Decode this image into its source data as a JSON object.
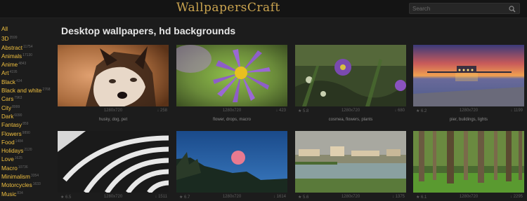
{
  "site": {
    "logo": "WallpapersCraft"
  },
  "search": {
    "placeholder": "Search"
  },
  "page": {
    "title": "Desktop wallpapers, hd backgrounds"
  },
  "sidebar": {
    "items": [
      {
        "label": "All",
        "count": ""
      },
      {
        "label": "3D",
        "count": "3599"
      },
      {
        "label": "Abstract",
        "count": "11754"
      },
      {
        "label": "Animals",
        "count": "17130"
      },
      {
        "label": "Anime",
        "count": "4843"
      },
      {
        "label": "Art",
        "count": "4195"
      },
      {
        "label": "Black",
        "count": "434"
      },
      {
        "label": "Black and white",
        "count": "2768"
      },
      {
        "label": "Cars",
        "count": "7963"
      },
      {
        "label": "City",
        "count": "8999"
      },
      {
        "label": "Dark",
        "count": "6090"
      },
      {
        "label": "Fantasy",
        "count": "859"
      },
      {
        "label": "Flowers",
        "count": "9890"
      },
      {
        "label": "Food",
        "count": "1484"
      },
      {
        "label": "Holidays",
        "count": "2120"
      },
      {
        "label": "Love",
        "count": "1625"
      },
      {
        "label": "Macro",
        "count": "10736"
      },
      {
        "label": "Minimalism",
        "count": "3354"
      },
      {
        "label": "Motorcycles",
        "count": "1633"
      },
      {
        "label": "Music",
        "count": "834"
      }
    ]
  },
  "wallpapers": [
    {
      "resolution": "1280x720",
      "rating": "",
      "downloads": "258",
      "tags": "husky, dog, pet",
      "icon": "husky-dog-thumbnail"
    },
    {
      "resolution": "1280x720",
      "rating": "",
      "downloads": "423",
      "tags": "flower, drops, macro",
      "icon": "purple-flower-thumbnail"
    },
    {
      "resolution": "1280x720",
      "rating": "5.8",
      "downloads": "680",
      "tags": "cosmea, flowers, plants",
      "icon": "cosmea-flowers-thumbnail"
    },
    {
      "resolution": "1280x720",
      "rating": "6.2",
      "downloads": "1199",
      "tags": "pier, buildings, lights",
      "icon": "pier-sunset-thumbnail"
    },
    {
      "resolution": "1280x720",
      "rating": "6.5",
      "downloads": "1511",
      "tags": "",
      "icon": "stairs-bw-thumbnail"
    },
    {
      "resolution": "1280x720",
      "rating": "6.7",
      "downloads": "1614",
      "tags": "",
      "icon": "moon-forest-thumbnail"
    },
    {
      "resolution": "1280x720",
      "rating": "5.6",
      "downloads": "1375",
      "tags": "",
      "icon": "lake-town-thumbnail"
    },
    {
      "resolution": "1280x720",
      "rating": "6.1",
      "downloads": "2295",
      "tags": "",
      "icon": "forest-trees-thumbnail"
    }
  ],
  "colors": {
    "accent": "#f0c040",
    "logo": "#c9a34f",
    "background": "#1c1c1c"
  }
}
